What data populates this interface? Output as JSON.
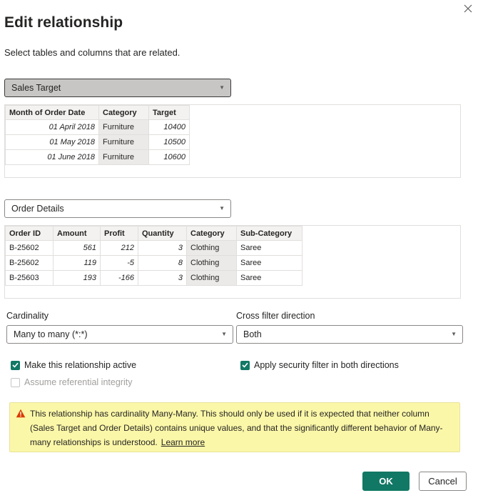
{
  "dialog": {
    "title": "Edit relationship",
    "subtitle": "Select tables and columns that are related."
  },
  "table1": {
    "selected": "Sales Target",
    "columns": [
      "Month of Order Date",
      "Category",
      "Target"
    ],
    "rows": [
      [
        "01 April 2018",
        "Furniture",
        "10400"
      ],
      [
        "01 May 2018",
        "Furniture",
        "10500"
      ],
      [
        "01 June 2018",
        "Furniture",
        "10600"
      ]
    ]
  },
  "table2": {
    "selected": "Order Details",
    "columns": [
      "Order ID",
      "Amount",
      "Profit",
      "Quantity",
      "Category",
      "Sub-Category"
    ],
    "rows": [
      [
        "B-25602",
        "561",
        "212",
        "3",
        "Clothing",
        "Saree"
      ],
      [
        "B-25602",
        "119",
        "-5",
        "8",
        "Clothing",
        "Saree"
      ],
      [
        "B-25603",
        "193",
        "-166",
        "3",
        "Clothing",
        "Saree"
      ]
    ]
  },
  "cardinality": {
    "label": "Cardinality",
    "value": "Many to many (*:*)"
  },
  "cross_filter": {
    "label": "Cross filter direction",
    "value": "Both"
  },
  "options": {
    "active_label": "Make this relationship active",
    "active_checked": true,
    "referential_label": "Assume referential integrity",
    "referential_checked": false,
    "security_label": "Apply security filter in both directions",
    "security_checked": true
  },
  "warning": {
    "text": "This relationship has cardinality Many-Many. This should only be used if it is expected that neither column (Sales Target and Order Details) contains unique values, and that the significantly different behavior of Many-many relationships is understood.",
    "link": "Learn more"
  },
  "buttons": {
    "ok": "OK",
    "cancel": "Cancel"
  },
  "colors": {
    "accent": "#117865",
    "warning_bg": "#fbf7a8",
    "warning_icon": "#d83b01"
  },
  "icons": {
    "close": "close-icon",
    "dropdown": "chevron-down-icon",
    "check": "checkmark-icon",
    "warning": "warning-icon"
  }
}
